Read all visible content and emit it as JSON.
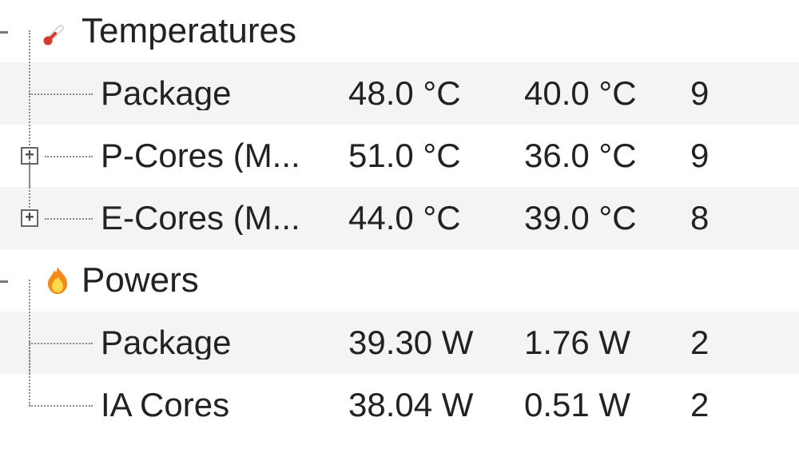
{
  "groups": {
    "temperatures": {
      "title": "Temperatures",
      "rows": [
        {
          "label": "Package",
          "v1": "48.0 °C",
          "v2": "40.0 °C",
          "v3": "9"
        },
        {
          "label": "P-Cores (M...",
          "v1": "51.0 °C",
          "v2": "36.0 °C",
          "v3": "9"
        },
        {
          "label": "E-Cores (M...",
          "v1": "44.0 °C",
          "v2": "39.0 °C",
          "v3": "8"
        }
      ]
    },
    "powers": {
      "title": "Powers",
      "rows": [
        {
          "label": "Package",
          "v1": "39.30 W",
          "v2": "1.76 W",
          "v3": "2"
        },
        {
          "label": "IA Cores",
          "v1": "38.04 W",
          "v2": "0.51 W",
          "v3": "2"
        }
      ]
    }
  }
}
